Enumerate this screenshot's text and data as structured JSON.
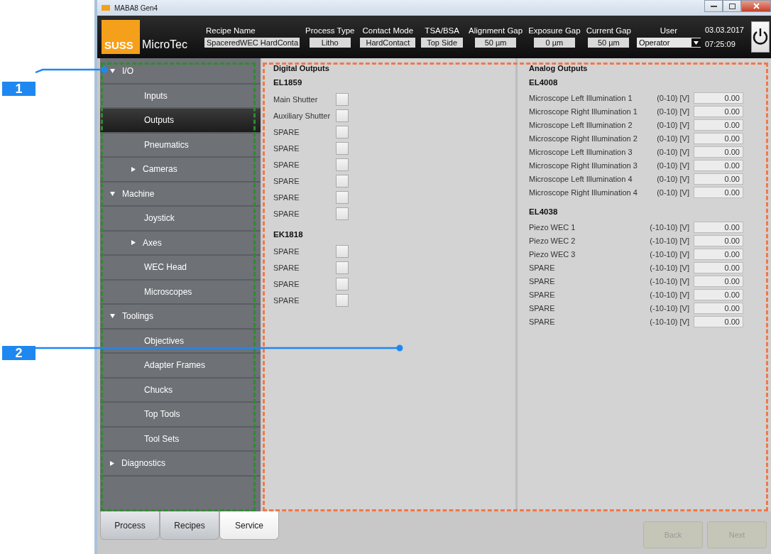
{
  "window": {
    "title": "MABA8 Gen4"
  },
  "header": {
    "logo": {
      "brand": "SUSS",
      "name": "MicroTec"
    },
    "fields": [
      {
        "label": "Recipe Name",
        "value": "SpaceredWEC HardConta",
        "kind": "wide"
      },
      {
        "label": "Process Type",
        "value": "Litho",
        "kind": "box"
      },
      {
        "label": "Contact Mode",
        "value": "HardContact",
        "kind": "box"
      },
      {
        "label": "TSA/BSA",
        "value": "Top Side",
        "kind": "box"
      },
      {
        "label": "Alignment Gap",
        "value": "50 µm",
        "kind": "box"
      },
      {
        "label": "Exposure Gap",
        "value": "0 µm",
        "kind": "box"
      },
      {
        "label": "Current Gap",
        "value": "50 µm",
        "kind": "box"
      },
      {
        "label": "User",
        "value": "Operator",
        "kind": "dropdown"
      }
    ],
    "date": "03.03.2017",
    "time": "07:25:09"
  },
  "sidebar": {
    "items": [
      {
        "label": "I/O",
        "kind": "group",
        "expanded": true,
        "selected": false,
        "children": [
          {
            "label": "Inputs",
            "kind": "item",
            "selected": false
          },
          {
            "label": "Outputs",
            "kind": "item",
            "selected": true
          },
          {
            "label": "Pneumatics",
            "kind": "item",
            "selected": false
          },
          {
            "label": "Cameras",
            "kind": "group",
            "expanded": false,
            "selected": false
          }
        ]
      },
      {
        "label": "Machine",
        "kind": "group",
        "expanded": true,
        "selected": false,
        "children": [
          {
            "label": "Joystick",
            "kind": "item",
            "selected": false
          },
          {
            "label": "Axes",
            "kind": "group",
            "expanded": false,
            "selected": false
          },
          {
            "label": "WEC Head",
            "kind": "item",
            "selected": false
          },
          {
            "label": "Microscopes",
            "kind": "item",
            "selected": false
          }
        ]
      },
      {
        "label": "Toolings",
        "kind": "group",
        "expanded": true,
        "selected": false,
        "children": [
          {
            "label": "Objectives",
            "kind": "item",
            "selected": false
          },
          {
            "label": "Adapter Frames",
            "kind": "item",
            "selected": false
          },
          {
            "label": "Chucks",
            "kind": "item",
            "selected": false
          },
          {
            "label": "Top Tools",
            "kind": "item",
            "selected": false
          },
          {
            "label": "Tool Sets",
            "kind": "item",
            "selected": false
          }
        ]
      },
      {
        "label": "Diagnostics",
        "kind": "group",
        "expanded": false,
        "selected": false
      }
    ]
  },
  "digital_outputs": {
    "title": "Digital Outputs",
    "modules": [
      {
        "name": "EL1859",
        "channels": [
          {
            "label": "Main Shutter",
            "checked": false
          },
          {
            "label": "Auxiliary Shutter",
            "checked": false
          },
          {
            "label": "SPARE",
            "checked": false
          },
          {
            "label": "SPARE",
            "checked": false
          },
          {
            "label": "SPARE",
            "checked": false
          },
          {
            "label": "SPARE",
            "checked": false
          },
          {
            "label": "SPARE",
            "checked": false
          },
          {
            "label": "SPARE",
            "checked": false
          }
        ]
      },
      {
        "name": "EK1818",
        "channels": [
          {
            "label": "SPARE",
            "checked": false
          },
          {
            "label": "SPARE",
            "checked": false
          },
          {
            "label": "SPARE",
            "checked": false
          },
          {
            "label": "SPARE",
            "checked": false
          }
        ]
      }
    ]
  },
  "analog_outputs": {
    "title": "Analog Outputs",
    "modules": [
      {
        "name": "EL4008",
        "channels": [
          {
            "label": "Microscope Left Illumination 1",
            "range": "(0-10) [V]",
            "value": "0.00"
          },
          {
            "label": "Microscope Right Illumination 1",
            "range": "(0-10) [V]",
            "value": "0.00"
          },
          {
            "label": "Microscope Left Illumination 2",
            "range": "(0-10) [V]",
            "value": "0.00"
          },
          {
            "label": "Microscope Right Illumination 2",
            "range": "(0-10) [V]",
            "value": "0.00"
          },
          {
            "label": "Microscope Left Illumination 3",
            "range": "(0-10) [V]",
            "value": "0.00"
          },
          {
            "label": "Microscope Right Illumination 3",
            "range": "(0-10) [V]",
            "value": "0.00"
          },
          {
            "label": "Microscope Left Illumination 4",
            "range": "(0-10) [V]",
            "value": "0.00"
          },
          {
            "label": "Microscope Right Illumination 4",
            "range": "(0-10) [V]",
            "value": "0.00"
          }
        ]
      },
      {
        "name": "EL4038",
        "channels": [
          {
            "label": "Piezo WEC 1",
            "range": "(-10-10) [V]",
            "value": "0.00"
          },
          {
            "label": "Piezo WEC 2",
            "range": "(-10-10) [V]",
            "value": "0.00"
          },
          {
            "label": "Piezo WEC 3",
            "range": "(-10-10) [V]",
            "value": "0.00"
          },
          {
            "label": "SPARE",
            "range": "(-10-10) [V]",
            "value": "0.00"
          },
          {
            "label": "SPARE",
            "range": "(-10-10) [V]",
            "value": "0.00"
          },
          {
            "label": "SPARE",
            "range": "(-10-10) [V]",
            "value": "0.00"
          },
          {
            "label": "SPARE",
            "range": "(-10-10) [V]",
            "value": "0.00"
          },
          {
            "label": "SPARE",
            "range": "(-10-10) [V]",
            "value": "0.00"
          }
        ]
      }
    ]
  },
  "bottom_tabs": [
    {
      "label": "Process",
      "selected": false
    },
    {
      "label": "Recipes",
      "selected": false
    },
    {
      "label": "Service",
      "selected": true
    }
  ],
  "nav_buttons": [
    {
      "label": "Back",
      "disabled": true
    },
    {
      "label": "Next",
      "disabled": true
    }
  ],
  "callouts": [
    {
      "number": "1"
    },
    {
      "number": "2"
    }
  ]
}
